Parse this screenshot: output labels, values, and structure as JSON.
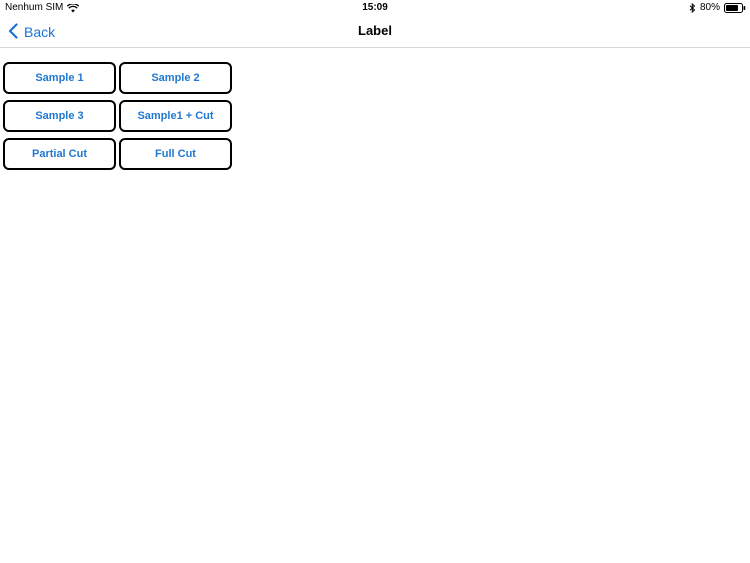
{
  "status_bar": {
    "carrier": "Nenhum SIM",
    "time": "15:09",
    "battery_percent": "80%",
    "battery_level": 0.8,
    "icons": [
      "wifi-icon",
      "bluetooth-icon",
      "battery-icon"
    ]
  },
  "nav": {
    "back_label": "Back",
    "title": "Label",
    "accent_color": "#1a73d9"
  },
  "buttons": [
    {
      "label": "Sample 1"
    },
    {
      "label": "Sample 2"
    },
    {
      "label": "Sample 3"
    },
    {
      "label": "Sample1 + Cut"
    },
    {
      "label": "Partial Cut"
    },
    {
      "label": "Full Cut"
    }
  ]
}
